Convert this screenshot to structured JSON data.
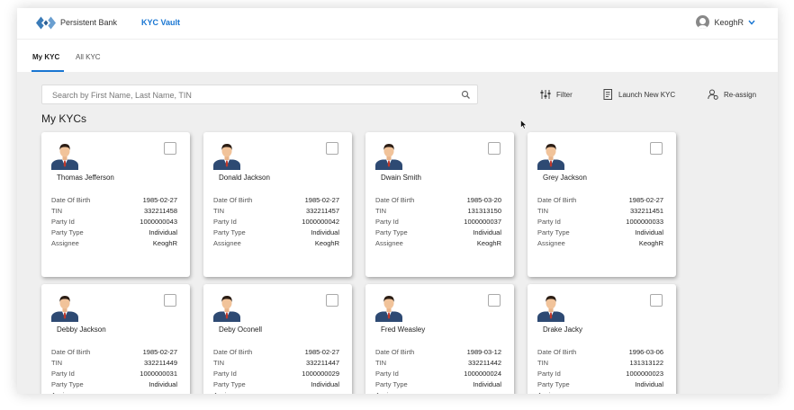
{
  "header": {
    "brand": "Persistent Bank",
    "app": "KYC Vault",
    "user": "KeoghR"
  },
  "tabs": [
    {
      "label": "My KYC",
      "active": true
    },
    {
      "label": "All KYC",
      "active": false
    }
  ],
  "search": {
    "placeholder": "Search by First Name, Last Name, TIN",
    "value": ""
  },
  "actions": {
    "filter": "Filter",
    "launch": "Launch New KYC",
    "reassign": "Re-assign"
  },
  "section_title": "My KYCs",
  "field_labels": {
    "dob": "Date Of Birth",
    "tin": "TIN",
    "party_id": "Party Id",
    "party_type": "Party Type",
    "assignee": "Assignee"
  },
  "cards": [
    {
      "name": "Thomas Jefferson",
      "dob": "1985-02-27",
      "tin": "332211458",
      "party_id": "1000000043",
      "party_type": "Individual",
      "assignee": "KeoghR"
    },
    {
      "name": "Donald Jackson",
      "dob": "1985-02-27",
      "tin": "332211457",
      "party_id": "1000000042",
      "party_type": "Individual",
      "assignee": "KeoghR"
    },
    {
      "name": "Dwain Smith",
      "dob": "1985-03-20",
      "tin": "131313150",
      "party_id": "1000000037",
      "party_type": "Individual",
      "assignee": "KeoghR"
    },
    {
      "name": "Grey Jackson",
      "dob": "1985-02-27",
      "tin": "332211451",
      "party_id": "1000000033",
      "party_type": "Individual",
      "assignee": "KeoghR"
    },
    {
      "name": "Debby Jackson",
      "dob": "1985-02-27",
      "tin": "332211449",
      "party_id": "1000000031",
      "party_type": "Individual",
      "assignee": ""
    },
    {
      "name": "Deby Oconell",
      "dob": "1985-02-27",
      "tin": "332211447",
      "party_id": "1000000029",
      "party_type": "Individual",
      "assignee": ""
    },
    {
      "name": "Fred Weasley",
      "dob": "1989-03-12",
      "tin": "332211442",
      "party_id": "1000000024",
      "party_type": "Individual",
      "assignee": ""
    },
    {
      "name": "Drake Jacky",
      "dob": "1996-03-06",
      "tin": "131313122",
      "party_id": "1000000023",
      "party_type": "Individual",
      "assignee": ""
    }
  ],
  "colors": {
    "accent": "#1976d2",
    "logo": "#3a7bb8"
  }
}
